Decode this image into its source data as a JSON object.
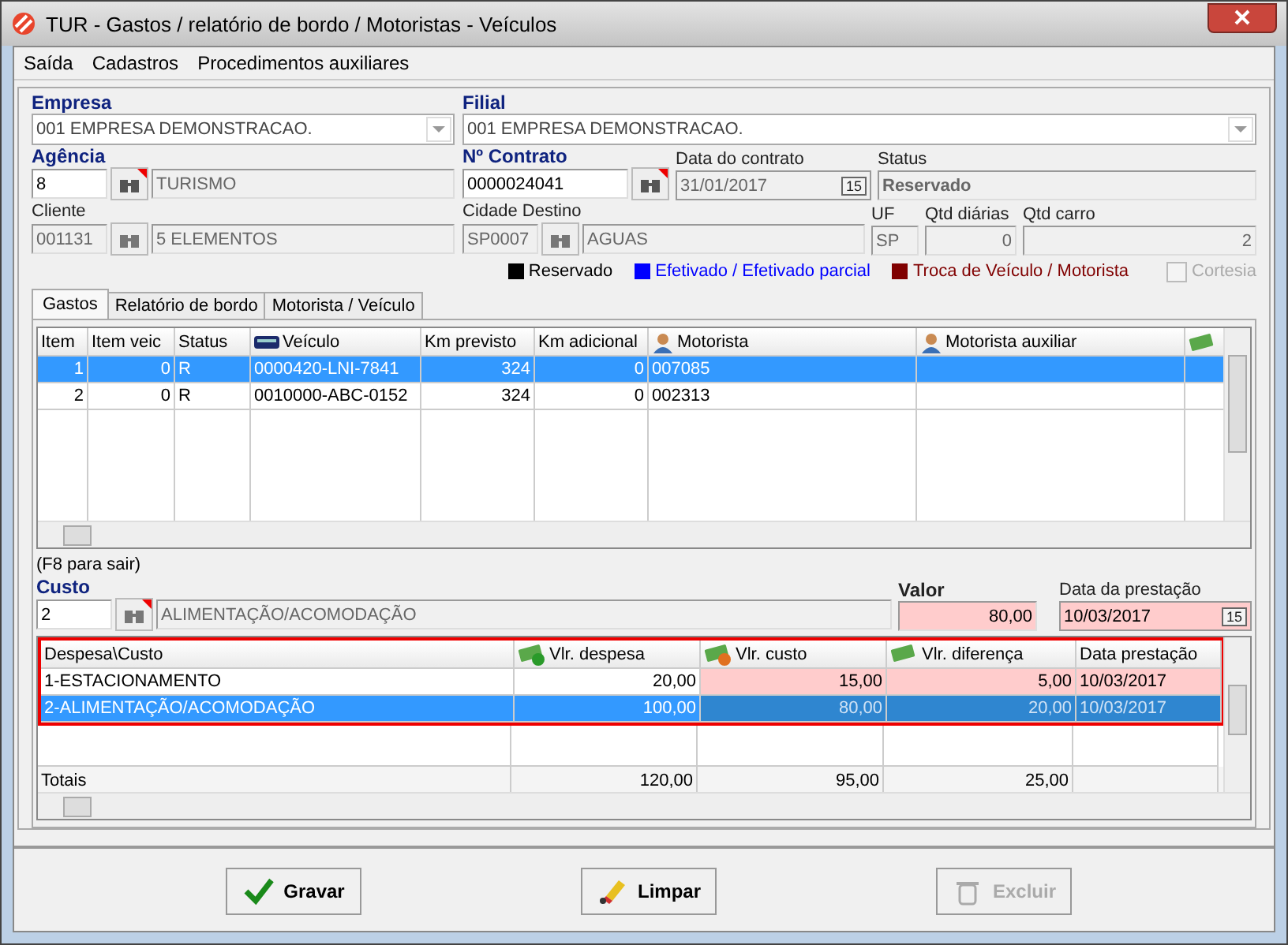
{
  "window": {
    "title": "TUR - Gastos / relatório de bordo / Motoristas - Veículos"
  },
  "menu": [
    "Saída",
    "Cadastros",
    "Procedimentos auxiliares"
  ],
  "empresa": {
    "label": "Empresa",
    "value": "001 EMPRESA DEMONSTRACAO."
  },
  "filial": {
    "label": "Filial",
    "value": "001 EMPRESA DEMONSTRACAO."
  },
  "agencia": {
    "label": "Agência",
    "code": "8",
    "name": "TURISMO"
  },
  "contrato": {
    "label": "Nº Contrato",
    "value": "0000024041"
  },
  "data_contrato": {
    "label": "Data do contrato",
    "value": "31/01/2017",
    "calendar": "15"
  },
  "status": {
    "label": "Status",
    "value": "Reservado"
  },
  "cliente": {
    "label": "Cliente",
    "code": "001131",
    "name": "5 ELEMENTOS"
  },
  "cidade": {
    "label": "Cidade Destino",
    "code": "SP0007",
    "name": "AGUAS"
  },
  "uf": {
    "label": "UF",
    "value": "SP"
  },
  "qtd_diarias": {
    "label": "Qtd diárias",
    "value": "0"
  },
  "qtd_carro": {
    "label": "Qtd carro",
    "value": "2"
  },
  "legend": [
    {
      "label": "Reservado",
      "color": "#000000"
    },
    {
      "label": "Efetivado / Efetivado parcial",
      "color": "#0000ff"
    },
    {
      "label": "Troca de Veículo / Motorista",
      "color": "#800000"
    }
  ],
  "cortesia": {
    "label": "Cortesia",
    "checked": false
  },
  "tabs": [
    {
      "label": "Gastos",
      "selected": true
    },
    {
      "label": "Relatório de bordo",
      "selected": false
    },
    {
      "label": "Motorista / Veículo",
      "selected": false
    }
  ],
  "vehicles": {
    "columns": [
      {
        "label": "Item",
        "kind": "plain"
      },
      {
        "label": "Item veic",
        "kind": "plain"
      },
      {
        "label": "Status",
        "kind": "plain"
      },
      {
        "label": "Veículo",
        "kind": "bus"
      },
      {
        "label": "Km previsto",
        "kind": "plain"
      },
      {
        "label": "Km adicional",
        "kind": "plain"
      },
      {
        "label": "Motorista",
        "kind": "person"
      },
      {
        "label": "Motorista auxiliar",
        "kind": "person"
      },
      {
        "kind": "money"
      }
    ],
    "rows": [
      {
        "selected": true,
        "cells": [
          "1",
          "0",
          "R",
          "0000420-LNI-7841",
          "324",
          "0",
          "007085"
        ]
      },
      {
        "selected": false,
        "cells": [
          "2",
          "0",
          "R",
          "0010000-ABC-0152",
          "324",
          "0",
          "002313"
        ]
      }
    ]
  },
  "custo": {
    "hint": "(F8 para sair)",
    "label": "Custo",
    "code": "2",
    "name": "ALIMENTAÇÃO/ACOMODAÇÃO"
  },
  "valor": {
    "label": "Valor",
    "value": "80,00"
  },
  "data_prestacao": {
    "label": "Data da prestação",
    "value": "10/03/2017",
    "calendar": "15"
  },
  "expenses": {
    "columns": [
      {
        "label": "Despesa\\Custo",
        "kind": "plain",
        "highlighted": false
      },
      {
        "label": "Vlr. despesa",
        "kind": "money-plus",
        "highlighted": false
      },
      {
        "label": "Vlr. custo",
        "kind": "money-minus",
        "highlighted": true
      },
      {
        "label": "Vlr. diferença",
        "kind": "money",
        "highlighted": true
      },
      {
        "label": "Data prestação",
        "kind": "plain",
        "highlighted": true
      }
    ],
    "rows": [
      {
        "selected": false,
        "cells": [
          "1-ESTACIONAMENTO",
          "20,00",
          "15,00",
          "5,00",
          "10/03/2017"
        ]
      },
      {
        "selected": true,
        "cells": [
          "2-ALIMENTAÇÃO/ACOMODAÇÃO",
          "100,00",
          "80,00",
          "20,00",
          "10/03/2017"
        ]
      }
    ],
    "totals": [
      "Totais",
      "120,00",
      "95,00",
      "25,00"
    ]
  },
  "buttons": [
    {
      "label": "Gravar",
      "kind": "check",
      "disabled": false
    },
    {
      "label": "Limpar",
      "kind": "eraser",
      "disabled": false
    },
    {
      "label": "Excluir",
      "kind": "trash",
      "disabled": true
    }
  ]
}
